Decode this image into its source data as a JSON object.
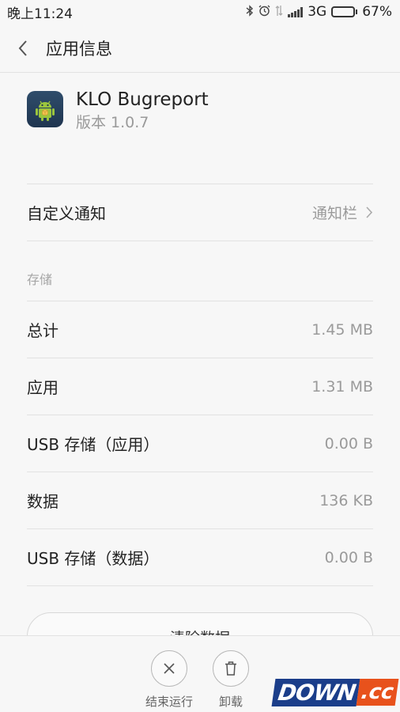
{
  "status_bar": {
    "time": "晚上11:24",
    "network": "3G",
    "battery": "67%",
    "battery_level": 0.67
  },
  "header": {
    "title": "应用信息"
  },
  "app": {
    "name": "KLO Bugreport",
    "version": "版本 1.0.7"
  },
  "notification": {
    "label": "自定义通知",
    "value": "通知栏"
  },
  "storage": {
    "section_label": "存储",
    "rows": [
      {
        "label": "总计",
        "value": "1.45 MB"
      },
      {
        "label": "应用",
        "value": "1.31 MB"
      },
      {
        "label": "USB 存储（应用）",
        "value": "0.00 B"
      },
      {
        "label": "数据",
        "value": "136 KB"
      },
      {
        "label": "USB 存储（数据）",
        "value": "0.00 B"
      }
    ]
  },
  "clear_data_label": "清除数据",
  "actions": {
    "force_stop": "结束运行",
    "uninstall": "卸载"
  },
  "watermark": {
    "main": "DOWN",
    "suffix": ".cc"
  }
}
